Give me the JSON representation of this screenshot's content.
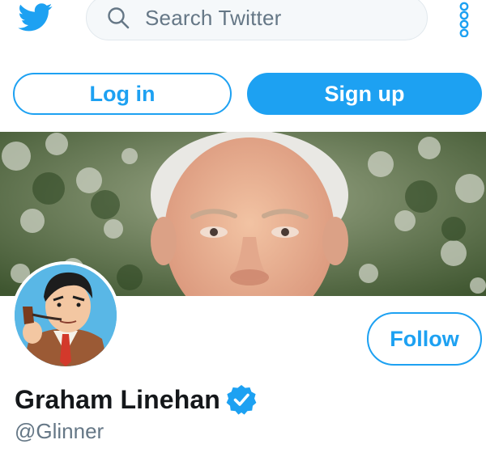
{
  "header": {
    "logo": "twitter-bird-icon",
    "search_placeholder": "Search Twitter",
    "more_icon": "vertical-dots-icon",
    "accent_color": "#1da1f2"
  },
  "auth": {
    "login_label": "Log in",
    "signup_label": "Sign up"
  },
  "profile": {
    "banner": "portrait-photo-banner",
    "avatar": "cartoon-avatar-with-pipe",
    "follow_label": "Follow",
    "name": "Graham Linehan",
    "verified": true,
    "handle": "@Glinner"
  }
}
